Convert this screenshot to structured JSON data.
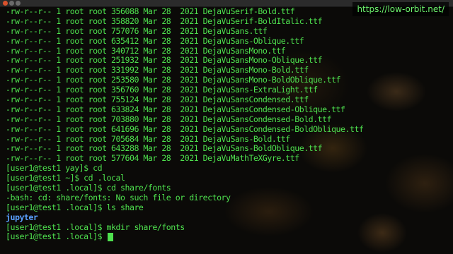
{
  "watermark": "https://low-orbit.net/",
  "terminal": {
    "file_lines": [
      "-rw-r--r-- 1 root root 356088 Mar 28  2021 DejaVuSerif-Bold.ttf",
      "-rw-r--r-- 1 root root 358820 Mar 28  2021 DejaVuSerif-BoldItalic.ttf",
      "-rw-r--r-- 1 root root 757076 Mar 28  2021 DejaVuSans.ttf",
      "-rw-r--r-- 1 root root 635412 Mar 28  2021 DejaVuSans-Oblique.ttf",
      "-rw-r--r-- 1 root root 340712 Mar 28  2021 DejaVuSansMono.ttf",
      "-rw-r--r-- 1 root root 251932 Mar 28  2021 DejaVuSansMono-Oblique.ttf",
      "-rw-r--r-- 1 root root 331992 Mar 28  2021 DejaVuSansMono-Bold.ttf",
      "-rw-r--r-- 1 root root 253580 Mar 28  2021 DejaVuSansMono-BoldOblique.ttf",
      "-rw-r--r-- 1 root root 356760 Mar 28  2021 DejaVuSans-ExtraLight.ttf",
      "-rw-r--r-- 1 root root 755124 Mar 28  2021 DejaVuSansCondensed.ttf",
      "-rw-r--r-- 1 root root 633824 Mar 28  2021 DejaVuSansCondensed-Oblique.ttf",
      "-rw-r--r-- 1 root root 703880 Mar 28  2021 DejaVuSansCondensed-Bold.ttf",
      "-rw-r--r-- 1 root root 641696 Mar 28  2021 DejaVuSansCondensed-BoldOblique.ttf",
      "-rw-r--r-- 1 root root 705684 Mar 28  2021 DejaVuSans-Bold.ttf",
      "-rw-r--r-- 1 root root 643288 Mar 28  2021 DejaVuSans-BoldOblique.ttf",
      "-rw-r--r-- 1 root root 577604 Mar 28  2021 DejaVuMathTeXGyre.ttf"
    ],
    "command_lines": [
      "[user1@test1 yay]$ cd",
      "[user1@test1 ~]$ cd .local",
      "[user1@test1 .local]$ cd share/fonts",
      "-bash: cd: share/fonts: No such file or directory",
      "[user1@test1 .local]$ ls share"
    ],
    "dir_listing": "jupyter",
    "after_lines": [
      "[user1@test1 .local]$ mkdir share/fonts"
    ],
    "current_prompt": "[user1@test1 .local]$ "
  },
  "colors": {
    "text": "#4ee04e",
    "directory": "#5aa0ff",
    "watermark_text": "#6ef56e"
  }
}
